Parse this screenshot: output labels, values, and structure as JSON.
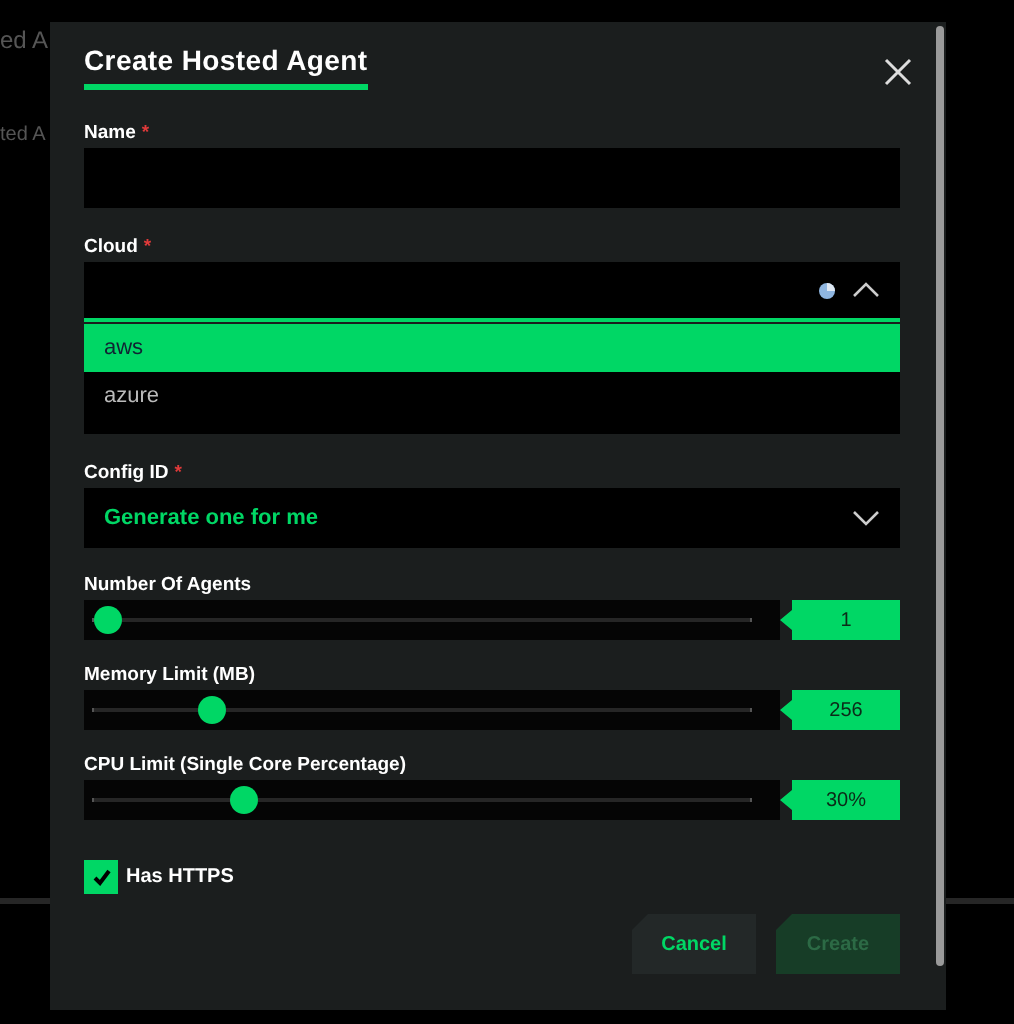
{
  "background": {
    "texts": [
      "ed A",
      "ted A"
    ]
  },
  "dialog": {
    "title": "Create Hosted Agent",
    "fields": [
      {
        "kind": "text",
        "label": "Name",
        "required_mark": "*"
      },
      {
        "kind": "select",
        "label": "Cloud",
        "required_mark": "*",
        "expanded": true,
        "loading": true,
        "options": [
          {
            "label": "aws",
            "selected": true
          },
          {
            "label": "azure",
            "selected": false
          }
        ]
      },
      {
        "kind": "select",
        "label": "Config ID",
        "required_mark": "*",
        "expanded": false,
        "value": "Generate one for me"
      }
    ],
    "sliders": [
      {
        "label": "Number Of Agents",
        "level": 0,
        "reading": "1"
      },
      {
        "label": "Memory Limit (MB)",
        "level": 0.18,
        "reading": "256"
      },
      {
        "label": "CPU Limit (Single Core Percentage)",
        "level": 0.23,
        "reading": "30%"
      }
    ],
    "checkbox": {
      "label": "Has HTTPS",
      "checked": true
    },
    "buttons": [
      {
        "label": "Cancel",
        "disabled": false
      },
      {
        "label": "Create",
        "disabled": true
      }
    ]
  }
}
